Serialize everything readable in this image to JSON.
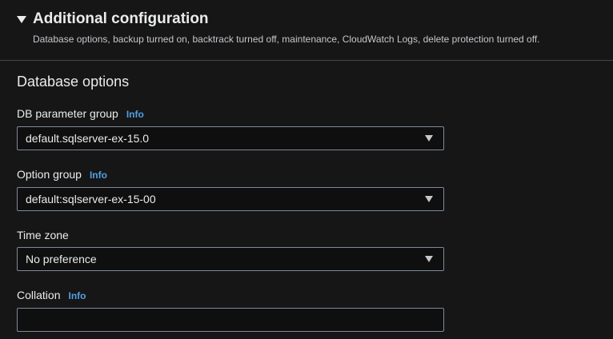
{
  "header": {
    "title": "Additional configuration",
    "description": "Database options, backup turned on, backtrack turned off, maintenance, CloudWatch Logs, delete protection turned off."
  },
  "section": {
    "title": "Database options"
  },
  "fields": {
    "db_parameter_group": {
      "label": "DB parameter group",
      "info": "Info",
      "value": "default.sqlserver-ex-15.0"
    },
    "option_group": {
      "label": "Option group",
      "info": "Info",
      "value": "default:sqlserver-ex-15-00"
    },
    "time_zone": {
      "label": "Time zone",
      "value": "No preference"
    },
    "collation": {
      "label": "Collation",
      "info": "Info",
      "value": ""
    }
  },
  "colors": {
    "background": "#161616",
    "text": "#e9ebed",
    "info_link": "#539fe5",
    "border": "#7d8998"
  }
}
